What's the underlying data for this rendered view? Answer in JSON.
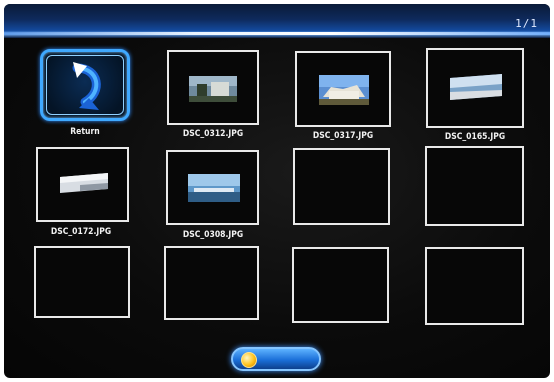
{
  "header": {
    "page_indicator": "1/1"
  },
  "grid": {
    "return_label": "Return",
    "files": [
      "DSC_0312.JPG",
      "DSC_0317.JPG",
      "DSC_0165.JPG",
      "DSC_0172.JPG",
      "DSC_0308.JPG"
    ]
  },
  "footer": {
    "button_text": ""
  },
  "colors": {
    "selection": "#3fa9ff",
    "tile_border": "#e9e9e9",
    "background": "#0b0b0b"
  }
}
